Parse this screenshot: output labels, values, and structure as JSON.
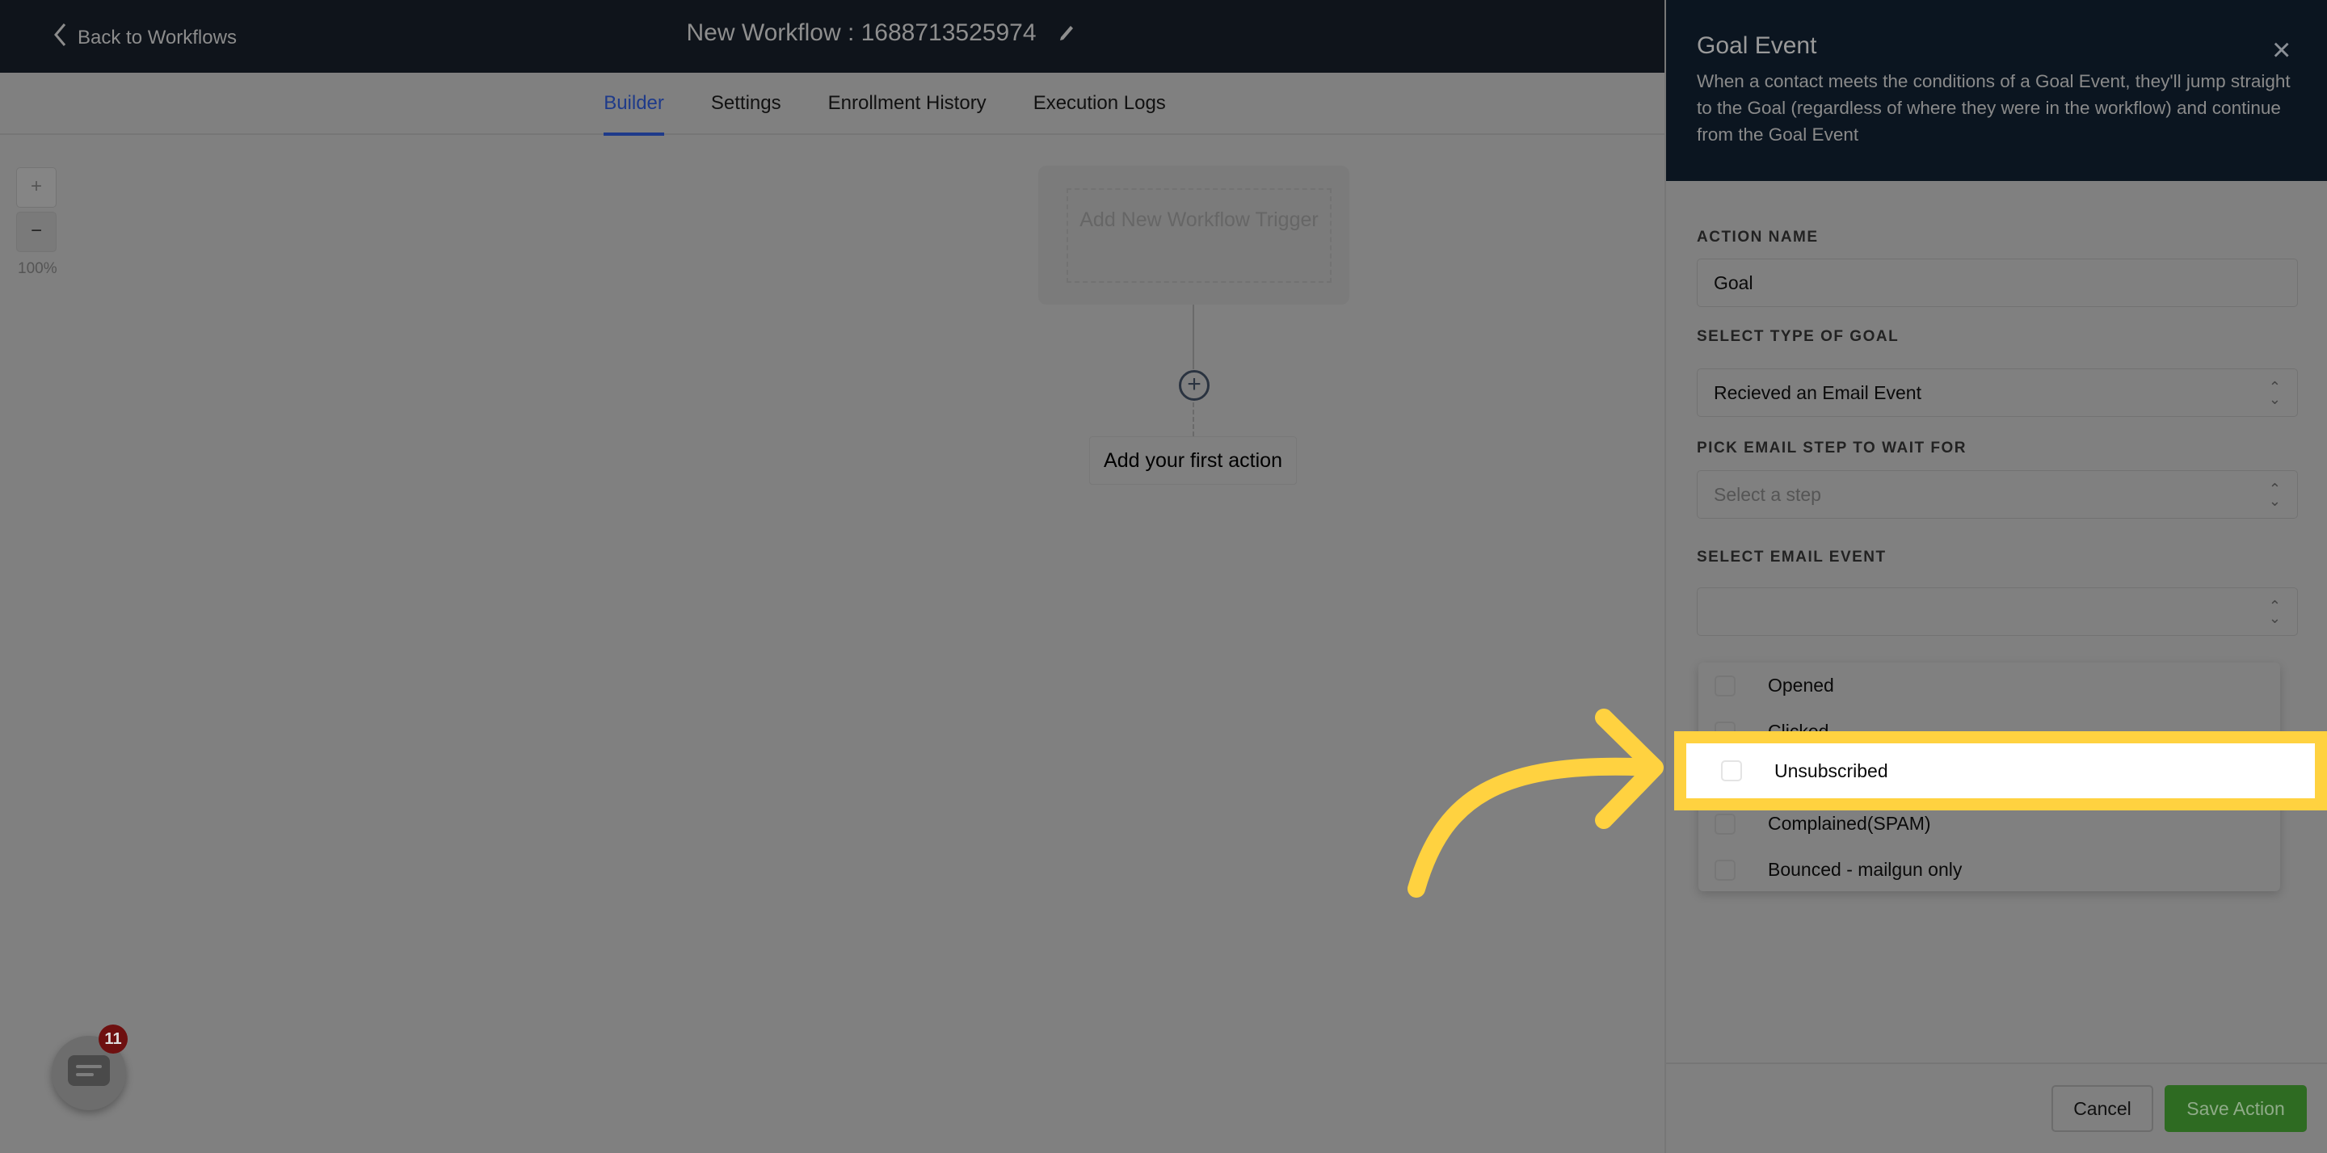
{
  "header": {
    "back_label": "Back to Workflows",
    "workflow_title": "New Workflow : 1688713525974"
  },
  "tabs": [
    {
      "label": "Builder",
      "active": true
    },
    {
      "label": "Settings"
    },
    {
      "label": "Enrollment History"
    },
    {
      "label": "Execution Logs"
    }
  ],
  "canvas": {
    "zoom_in": "+",
    "zoom_out": "−",
    "zoom_level": "100%",
    "trigger_label": "Add New Workflow Trigger",
    "add_action_icon": "+",
    "first_action_label": "Add your first action",
    "chat_badge_count": "11"
  },
  "panel": {
    "title": "Goal Event",
    "close_icon": "×",
    "description": "When a contact meets the conditions of a Goal Event, they'll jump straight to the Goal (regardless of where they were in the workflow) and continue from the Goal Event",
    "action_name_label": "ACTION NAME",
    "action_name_value": "Goal",
    "goal_type_label": "SELECT TYPE OF GOAL",
    "goal_type_value": "Recieved an Email Event",
    "email_step_label": "PICK EMAIL STEP TO WAIT FOR",
    "email_step_placeholder": "Select a step",
    "email_event_label": "SELECT EMAIL EVENT",
    "email_event_value": "",
    "email_event_options": [
      {
        "label": "Opened",
        "checked": false
      },
      {
        "label": "Clicked",
        "checked": false
      },
      {
        "label": "Unsubscribed",
        "checked": false,
        "highlighted": true
      },
      {
        "label": "Complained(SPAM)",
        "checked": false
      },
      {
        "label": "Bounced - mailgun only",
        "checked": false
      }
    ],
    "cancel_label": "Cancel",
    "save_label": "Save Action"
  },
  "colors": {
    "highlight": "#ffd240",
    "active_tab": "#1e3a8a",
    "save_button": "#2e6b22"
  }
}
